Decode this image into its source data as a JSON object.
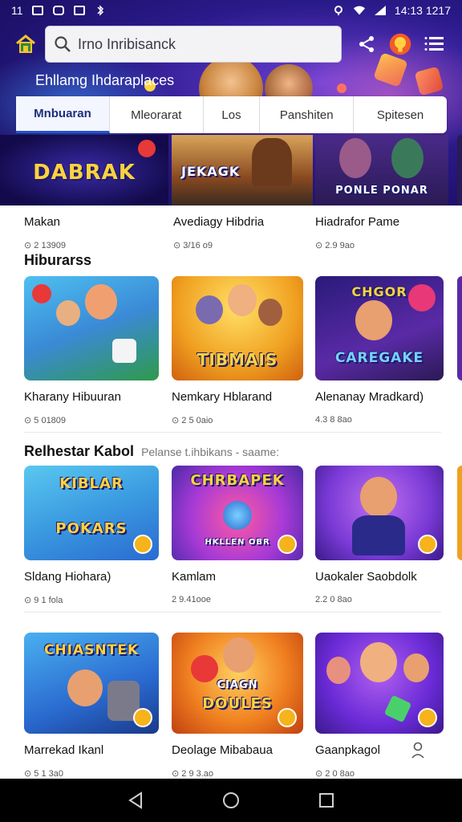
{
  "status_bar": {
    "time": "11",
    "right_text": "14:13 1217"
  },
  "search": {
    "value": "Irno Inribisanck"
  },
  "hero": {
    "title": "Ehllamg Ihdaraplaces"
  },
  "tabs": [
    {
      "label": "Mnbuaran",
      "active": true
    },
    {
      "label": "Mleorarat",
      "active": false
    },
    {
      "label": "Los",
      "active": false
    },
    {
      "label": "Panshiten",
      "active": false
    },
    {
      "label": "Spitesen",
      "active": false
    }
  ],
  "top_row": [
    {
      "thumb_text": "DABRAK",
      "name": "Makan",
      "meta": "⊙ 2 13909"
    },
    {
      "thumb_text": "JEKAGK",
      "name": "Avediagy Hibdria",
      "meta": "⊙ 3/16 o9"
    },
    {
      "thumb_text": "PONLE PONAR",
      "name": "Hiadrafor Pame",
      "meta": "⊙ 2.9 9ao"
    }
  ],
  "section1": {
    "title": "Hiburarss",
    "cards": [
      {
        "thumb_text": "",
        "name": "Kharany Hibuuran",
        "meta": "⊙ 5 01809"
      },
      {
        "thumb_text": "TIBMAIS",
        "name": "Nemkary Hblarand",
        "meta": "⊙ 2 5 0aio"
      },
      {
        "thumb_text": "CAREGAKE",
        "thumb_top": "CHGOR",
        "name": "Alenanay Mradkard)",
        "meta": "4.3 8 8ao"
      }
    ]
  },
  "section2": {
    "title": "Relhestar Kabol",
    "subtitle": "Pelanse t.ihbikans - saame:",
    "cards": [
      {
        "thumb_text": "POKARS",
        "thumb_top": "KIBLAR",
        "name": "Sldang Hiohara)",
        "meta": "⊙ 9 1 fola"
      },
      {
        "thumb_text": "CHRBAPEK",
        "thumb_bottom": "HKLLEN OBR",
        "name": "Kamlam",
        "meta": "2 9.41ooe"
      },
      {
        "thumb_text": "",
        "name": "Uaokaler Saobdolk",
        "meta": "2.2 0 8ao"
      }
    ]
  },
  "section3": {
    "cards": [
      {
        "thumb_text": "CHIASNTEK",
        "name": "Marrekad Ikanl",
        "meta": "⊙ 5 1 3a0"
      },
      {
        "thumb_text": "DOULES",
        "thumb_top": "CIAGN",
        "name": "Deolage Mibabaua",
        "meta": "⊙ 2 9 3.ao"
      },
      {
        "thumb_text": "",
        "name": "Gaanpkagol",
        "meta": "⊙ 2 0 8ao"
      }
    ]
  },
  "colors": {
    "accent": "#2453d0",
    "hero_bg": "#2a1a8a",
    "badge": "#f6b31b"
  }
}
